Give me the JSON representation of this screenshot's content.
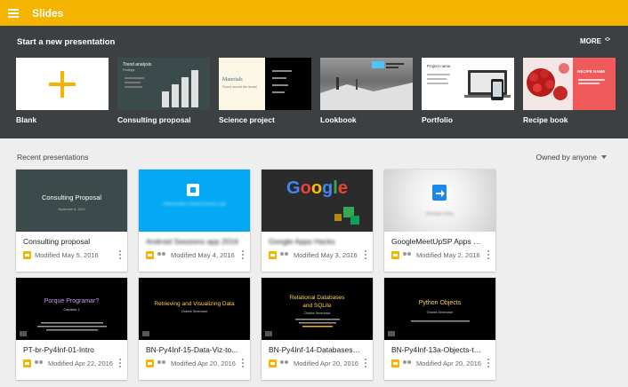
{
  "app": {
    "title": "Slides"
  },
  "templates": {
    "heading": "Start a new presentation",
    "more_label": "MORE",
    "items": [
      {
        "label": "Blank"
      },
      {
        "label": "Consulting proposal",
        "thumb_title": "Trend analysis",
        "thumb_sub": "Findings"
      },
      {
        "label": "Science project",
        "thumb_title": "Materials",
        "thumb_sub": "Found around the house!"
      },
      {
        "label": "Lookbook"
      },
      {
        "label": "Portfolio",
        "thumb_title": "Project name"
      },
      {
        "label": "Recipe book",
        "thumb_title": "RECIPE NAME"
      }
    ]
  },
  "recent": {
    "heading": "Recent presentations",
    "owner_filter": "Owned by anyone",
    "cards": [
      {
        "title": "Consulting proposal",
        "modified": "Modified May 5, 2016",
        "thumb_title": "Consulting Proposal",
        "thumb_sub": "September 8, 20XX"
      },
      {
        "title": "Android Sessions app 2016",
        "modified": "Modified May 4, 2016",
        "thumb_title": "SlidesScripts Android Sessions app"
      },
      {
        "title": "Google Apps Hacks",
        "modified": "Modified May 3, 2016",
        "thumb_title": "Google"
      },
      {
        "title": "GoogleMeetUpSP Apps S...",
        "modified": "Modified May 2, 2016",
        "thumb_title": "Henrique Abreu"
      },
      {
        "title": "PT-br-Py4Inf-01-Intro",
        "modified": "Modified Apr 22, 2016",
        "thumb_title": "Porque Programar?",
        "thumb_sub": "Capítulo 1"
      },
      {
        "title": "BN-Py4Inf-15-Data-Viz-to...",
        "modified": "Modified Apr 20, 2016",
        "thumb_title": "Retrieving and Visualizing Data",
        "thumb_sub": "Charles Severance"
      },
      {
        "title": "BN-Py4Inf-14-Databases-...",
        "modified": "Modified Apr 20, 2016",
        "thumb_title": "Relational Databases and SQLite",
        "thumb_sub": "Charles Severance"
      },
      {
        "title": "BN-Py4Inf-13a-Objects-to...",
        "modified": "Modified Apr 20, 2016",
        "thumb_title": "Python Objects",
        "thumb_sub": "Charles Severance"
      }
    ]
  }
}
